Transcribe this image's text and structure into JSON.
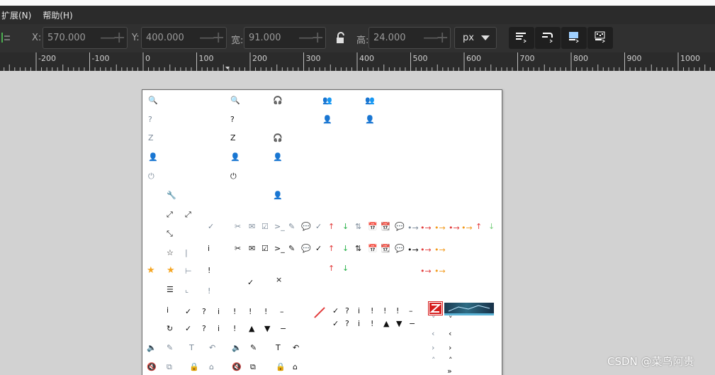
{
  "menubar": {
    "items": [
      "扩展(N)",
      "帮助(H)"
    ]
  },
  "toolbar": {
    "x_label": "X:",
    "x_value": "570.000",
    "y_label": "Y:",
    "y_value": "400.000",
    "w_label": "宽:",
    "w_value": "91.000",
    "h_label": "高:",
    "h_value": "24.000",
    "minus": "—",
    "plus": "+",
    "unit": "px"
  },
  "ruler": {
    "ticks": [
      "-200",
      "-100",
      "0",
      "100",
      "200",
      "300",
      "400",
      "500",
      "600",
      "700",
      "800",
      "900",
      "1000"
    ]
  },
  "glyphs": {
    "search": "🔍",
    "question": "?",
    "z": "Z",
    "power": "⏻",
    "wrench": "🔧",
    "expand": "⤢",
    "shrink": "⤡",
    "star_outline": "☆",
    "star_filled": "★",
    "bar": "|",
    "tee": "⊢",
    "corner": "⌞",
    "menu": "☰",
    "check_circle": "✓",
    "info_circle": "i",
    "warn": "!",
    "check": "✓",
    "cross": "×",
    "italic_i": "i",
    "refresh": "↻",
    "speaker": "🔈",
    "mute": "🔇",
    "pencil": "✎",
    "text_t": "T",
    "undo": "↶",
    "copy": "⧉",
    "lock": "🔒",
    "home": "⌂",
    "headset": "🎧",
    "users": "👥",
    "user": "👤",
    "tools": "✂",
    "mail": "✉",
    "checkbox": "☑",
    "prompt": ">_",
    "comment": "✎",
    "chat": "💬",
    "up": "↑",
    "down": "↓",
    "updown": "⇅",
    "cal_check": "📅",
    "cal": "📆",
    "bullet_arrow": "•→",
    "dash": "–",
    "slash": "/",
    "chev_down": "˅",
    "chev_left": "‹",
    "chev_right": "›",
    "chev_up": "˄",
    "dbl_right": "»",
    "excl": "!",
    "minus_circle": "−",
    "tri_up": "▲",
    "tri_down": "▼",
    "q_circle": "?",
    "i_circle": "i",
    "excl_circle": "!"
  },
  "watermark": "CSDN @菜鸟阿贵"
}
